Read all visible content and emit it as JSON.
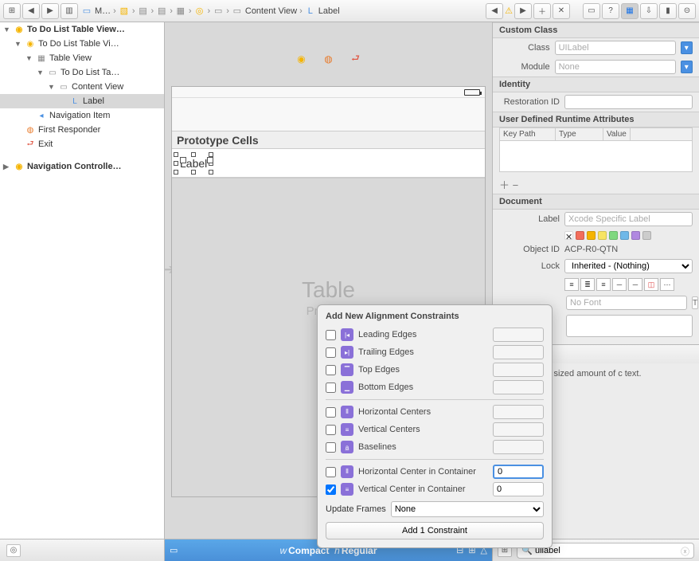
{
  "breadcrumb": {
    "items": [
      "M…",
      "",
      "",
      "",
      "",
      "",
      "",
      "Content View",
      "Label"
    ]
  },
  "outline": {
    "root": "To Do List Table View…",
    "n1": "To Do List Table Vi…",
    "n2": "Table View",
    "n3": "To Do List Ta…",
    "n4": "Content View",
    "n5": "Label",
    "n6": "Navigation Item",
    "n7": "First Responder",
    "n8": "Exit",
    "root2": "Navigation Controlle…"
  },
  "canvas": {
    "protoHeader": "Prototype Cells",
    "labelText": "Label",
    "placeholder1": "Table",
    "placeholder2": "Prototyp"
  },
  "sizeclass": {
    "wPrefix": "w",
    "w": "Compact",
    "hPrefix": "h",
    "h": "Regular"
  },
  "inspector": {
    "customClass": {
      "title": "Custom Class",
      "classLbl": "Class",
      "classPh": "UILabel",
      "moduleLbl": "Module",
      "modulePh": "None"
    },
    "identity": {
      "title": "Identity",
      "ridLbl": "Restoration ID"
    },
    "udra": {
      "title": "User Defined Runtime Attributes",
      "c1": "Key Path",
      "c2": "Type",
      "c3": "Value"
    },
    "document": {
      "title": "Document",
      "labelLbl": "Label",
      "labelPh": "Xcode Specific Label",
      "objIdLbl": "Object ID",
      "objId": "ACP-R0-QTN",
      "lockLbl": "Lock",
      "lockVal": "Inherited - (Nothing)",
      "noFont": "No Font"
    },
    "libDesc": "el - A variably sized amount of c text.",
    "libSearch": "uilabel"
  },
  "popover": {
    "title": "Add New Alignment Constraints",
    "rows": {
      "leading": "Leading Edges",
      "trailing": "Trailing Edges",
      "top": "Top Edges",
      "bottom": "Bottom Edges",
      "hcenters": "Horizontal Centers",
      "vcenters": "Vertical Centers",
      "baselines": "Baselines",
      "hcic": "Horizontal Center in Container",
      "vcic": "Vertical Center in Container"
    },
    "hcicVal": "0",
    "vcicVal": "0",
    "updateLbl": "Update Frames",
    "updateVal": "None",
    "addBtn": "Add 1 Constraint"
  }
}
